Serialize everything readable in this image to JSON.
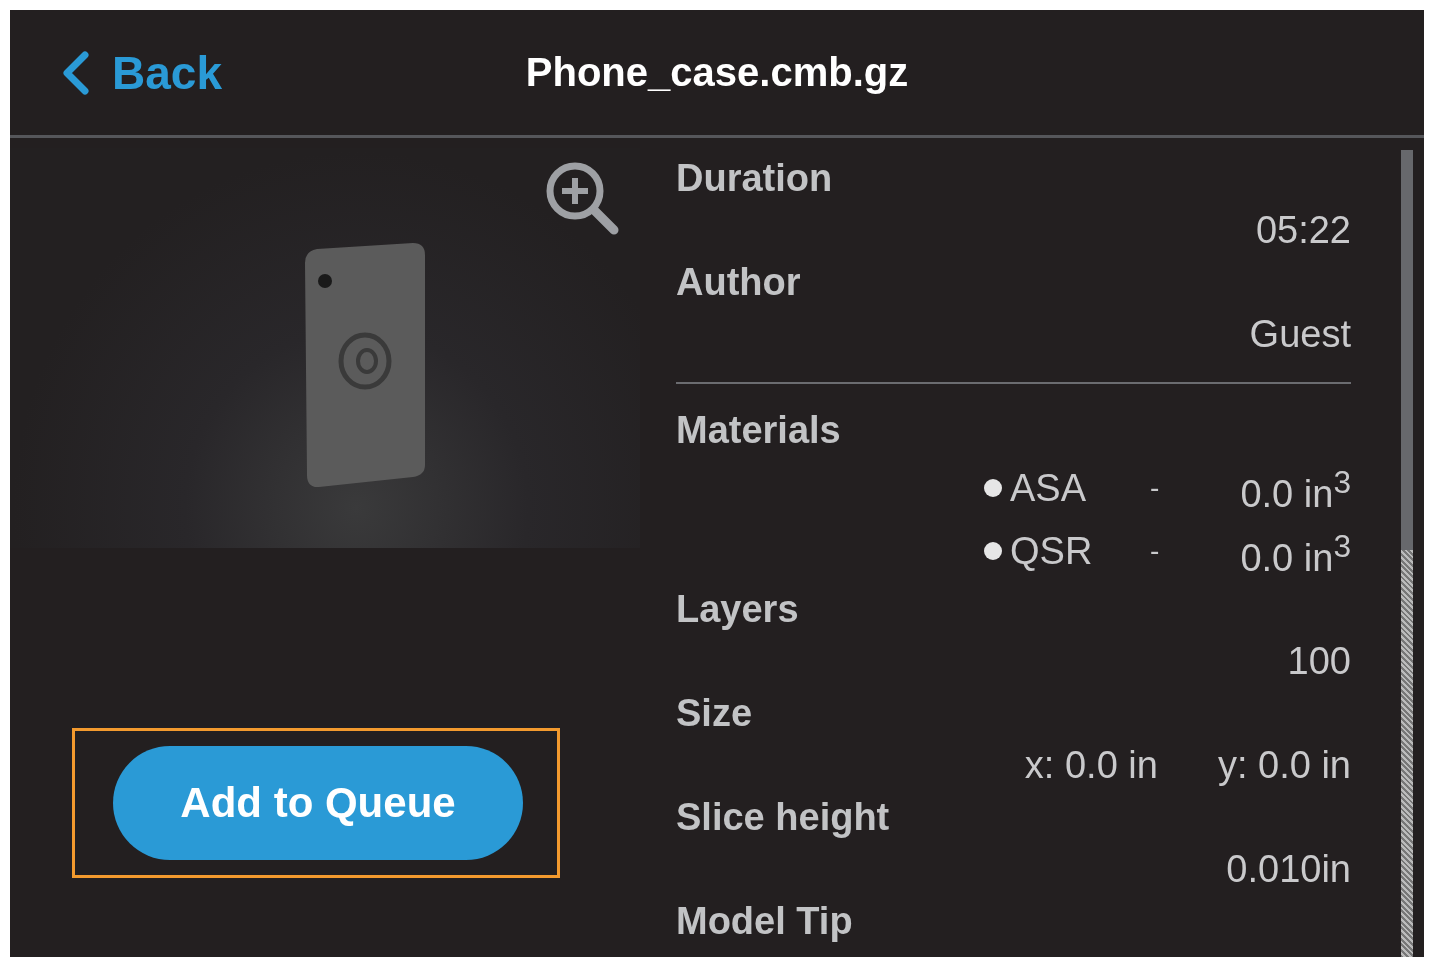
{
  "header": {
    "back_label": "Back",
    "title": "Phone_case.cmb.gz"
  },
  "action": {
    "label": "Add to Queue",
    "highlighted": true
  },
  "details": [
    {
      "kind": "field",
      "label": "Duration",
      "value": "05:22"
    },
    {
      "kind": "field",
      "label": "Author",
      "value": "Guest"
    },
    {
      "kind": "divider"
    },
    {
      "kind": "materials",
      "label": "Materials",
      "items": [
        {
          "name": "ASA",
          "dash": "-",
          "amount": "0.0 in$^{3}$"
        },
        {
          "name": "QSR",
          "dash": "-",
          "amount": "0.0 in$^{3}$"
        }
      ]
    },
    {
      "kind": "field",
      "label": "Layers",
      "value": "100"
    },
    {
      "kind": "size",
      "label": "Size",
      "x": "x: 0.0 in",
      "y": "y: 0.0 in"
    },
    {
      "kind": "field",
      "label": "Slice height",
      "value": "0.010in"
    },
    {
      "kind": "label",
      "label": "Model Tip"
    }
  ]
}
